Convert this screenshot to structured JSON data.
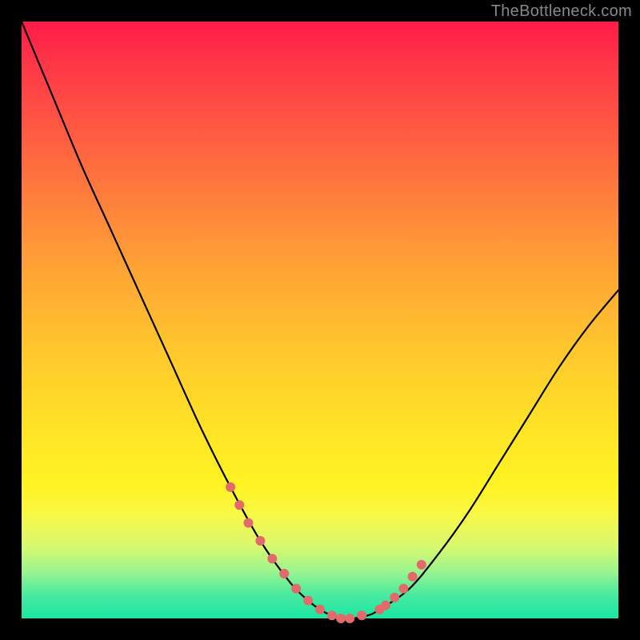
{
  "watermark": "TheBottleneck.com",
  "chart_data": {
    "type": "line",
    "title": "",
    "xlabel": "",
    "ylabel": "",
    "xlim": [
      0,
      100
    ],
    "ylim": [
      0,
      100
    ],
    "grid": false,
    "legend": false,
    "background_gradient": {
      "orientation": "vertical",
      "stops": [
        {
          "pos": 0.0,
          "color": "#ff1a49"
        },
        {
          "pos": 0.18,
          "color": "#ff5942"
        },
        {
          "pos": 0.42,
          "color": "#ffa534"
        },
        {
          "pos": 0.68,
          "color": "#ffe326"
        },
        {
          "pos": 0.83,
          "color": "#f8f84a"
        },
        {
          "pos": 0.92,
          "color": "#9df58e"
        },
        {
          "pos": 1.0,
          "color": "#19e6a3"
        }
      ]
    },
    "series": [
      {
        "name": "bottleneck-curve",
        "color": "#000000",
        "x": [
          0,
          5,
          10,
          15,
          20,
          25,
          30,
          35,
          40,
          45,
          48,
          50,
          52,
          55,
          58,
          60,
          65,
          70,
          75,
          80,
          85,
          90,
          95,
          100
        ],
        "y": [
          100,
          88,
          76,
          65,
          54,
          43,
          32,
          22,
          13,
          6,
          3,
          1.5,
          0.5,
          0,
          0.5,
          1.5,
          5,
          11,
          18,
          26,
          34,
          42,
          49,
          55
        ]
      }
    ],
    "markers": {
      "name": "highlight-dots",
      "color": "#e26a6a",
      "radius_px": 6,
      "x": [
        35,
        36.5,
        38,
        40,
        42,
        44,
        46,
        48,
        50,
        52,
        53.5,
        55,
        57,
        60,
        61,
        62.5,
        64,
        65.5,
        67
      ],
      "y": [
        22,
        19,
        16,
        13,
        10,
        7.5,
        5,
        3,
        1.5,
        0.5,
        0,
        0,
        0.5,
        1.5,
        2.2,
        3.5,
        5,
        7,
        9
      ]
    }
  }
}
